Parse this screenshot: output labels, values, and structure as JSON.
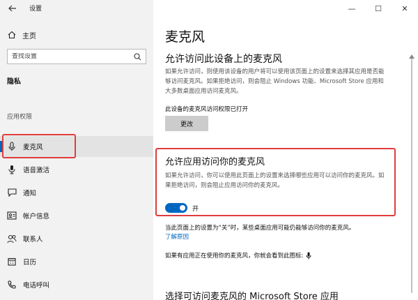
{
  "window": {
    "title": "设置",
    "controls": [
      "—",
      "☐",
      "✕"
    ]
  },
  "nav": {
    "home_label": "主页",
    "search_placeholder": "查找设置",
    "section_title": "隐私",
    "group_label": "应用权限",
    "items": [
      {
        "label": "麦克风",
        "icon": "microphone-icon"
      },
      {
        "label": "语音激活",
        "icon": "voice-activation-icon"
      },
      {
        "label": "通知",
        "icon": "notification-icon"
      },
      {
        "label": "帐户信息",
        "icon": "account-info-icon"
      },
      {
        "label": "联系人",
        "icon": "contacts-icon"
      },
      {
        "label": "日历",
        "icon": "calendar-icon"
      },
      {
        "label": "电话呼叫",
        "icon": "phone-call-icon"
      }
    ]
  },
  "main": {
    "page_title": "麦克风",
    "section1": {
      "title": "允许访问此设备上的麦克风",
      "description": "如果允许访问，则使用该设备的用户将可以使用该页面上的设置来选择其应用是否能够访问麦克风。如果拒绝访问，则会阻止 Windows 功能、Microsoft Store 应用和大多数桌面应用访问麦克风。",
      "status": "此设备的麦克风访问权限已打开",
      "button_label": "更改"
    },
    "section2": {
      "title": "允许应用访问你的麦克风",
      "description": "如果允许访问，你可以使用此页面上的设置来选择哪些应用可以访问你的麦克风。如果拒绝访问，则会阻止应用访问你的麦克风。",
      "toggle_state": "开",
      "toggle_on": true
    },
    "note": "当此页面上的设置为“关”时，某些桌面应用可能仍能够访问你的麦克风。",
    "learn_more": "了解原因",
    "indicator_text": "如果有应用正在使用你的麦克风，你就会看到此图标:",
    "section3_title": "选择可访问麦克风的 Microsoft Store 应用"
  },
  "colors": {
    "accent": "#0067c0",
    "highlight_box": "#e03c3c",
    "nav_background": "#f2f2f2"
  }
}
